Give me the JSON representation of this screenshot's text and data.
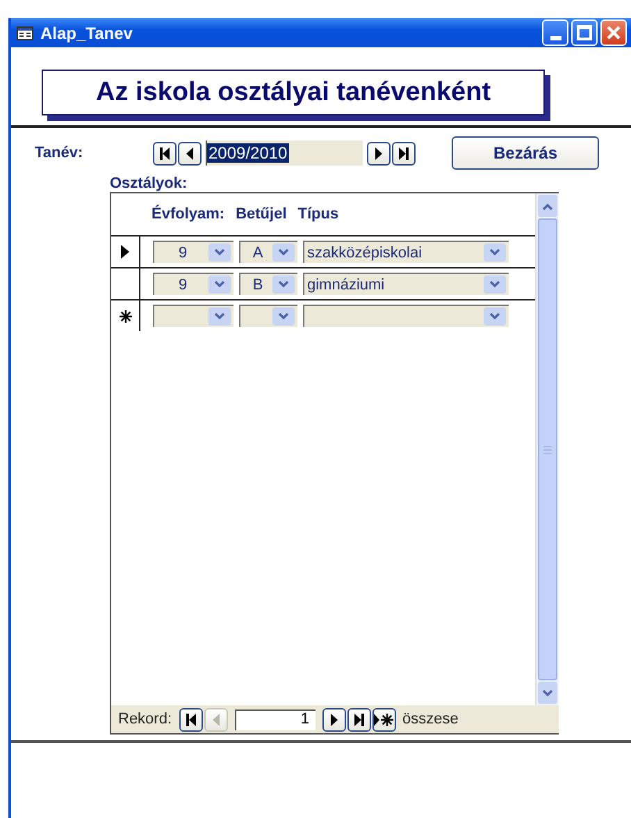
{
  "window": {
    "title": "Alap_Tanev"
  },
  "heading": "Az iskola osztályai tanévenként",
  "year_nav": {
    "label": "Tanév:",
    "value": "2009/2010",
    "buttons": [
      {
        "kind": "first",
        "disabled": false
      },
      {
        "kind": "prev",
        "disabled": false
      },
      {
        "kind": "next",
        "disabled": false
      },
      {
        "kind": "last",
        "disabled": false
      }
    ]
  },
  "close_button": "Bezárás",
  "subform": {
    "label": "Osztályok:",
    "columns": [
      "Évfolyam:",
      "Betűjel",
      "Típus"
    ],
    "rows": [
      {
        "kind": "record",
        "selected": true,
        "grade": "9",
        "letter": "A",
        "type": "szakközépiskolai"
      },
      {
        "kind": "record",
        "selected": false,
        "grade": "9",
        "letter": "B",
        "type": "gimnáziumi"
      },
      {
        "kind": "new",
        "selected": false
      }
    ]
  },
  "record_nav": {
    "label": "Rekord:",
    "value": "1",
    "total_label": "összese",
    "buttons": [
      {
        "kind": "first",
        "disabled": false
      },
      {
        "kind": "prev",
        "disabled": true
      },
      {
        "kind": "next",
        "disabled": false
      },
      {
        "kind": "last",
        "disabled": false
      },
      {
        "kind": "new",
        "disabled": false
      }
    ]
  }
}
